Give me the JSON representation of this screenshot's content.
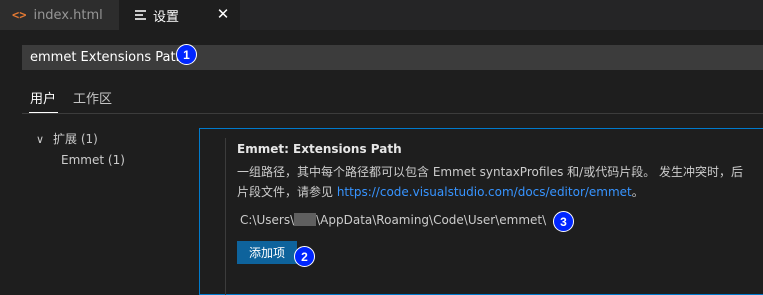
{
  "tabs": [
    {
      "icon": "html-file-icon",
      "icon_glyph": "<>",
      "label": "index.html"
    },
    {
      "icon": "settings-file-icon",
      "label": "设置",
      "close_glyph": "✕"
    }
  ],
  "search": {
    "value": "emmet Extensions Path"
  },
  "scope_tabs": {
    "user": "用户",
    "workspace": "工作区"
  },
  "toc": {
    "group": {
      "label": "扩展",
      "count": "(1)",
      "chevron": "∨"
    },
    "item": {
      "label": "Emmet",
      "count": "(1)"
    }
  },
  "setting": {
    "title": "Emmet: Extensions Path",
    "desc_line1": "一组路径，其中每个路径都可以包含 Emmet syntaxProfiles 和/或代码片段。 发生冲突时，后",
    "desc_line2_prefix": "片段文件，请参见 ",
    "desc_link": "https://code.visualstudio.com/docs/editor/emmet",
    "desc_line2_suffix": "。",
    "path_prefix": "C:\\Users\\",
    "path_suffix": "\\AppData\\Roaming\\Code\\User\\emmet\\",
    "add_button": "添加项"
  },
  "badges": [
    "1",
    "2",
    "3"
  ],
  "colors": {
    "accent": "#007acc",
    "badge": "#0026ff",
    "link": "#3794ff",
    "button": "#0e639c",
    "html_icon": "#e37933"
  }
}
